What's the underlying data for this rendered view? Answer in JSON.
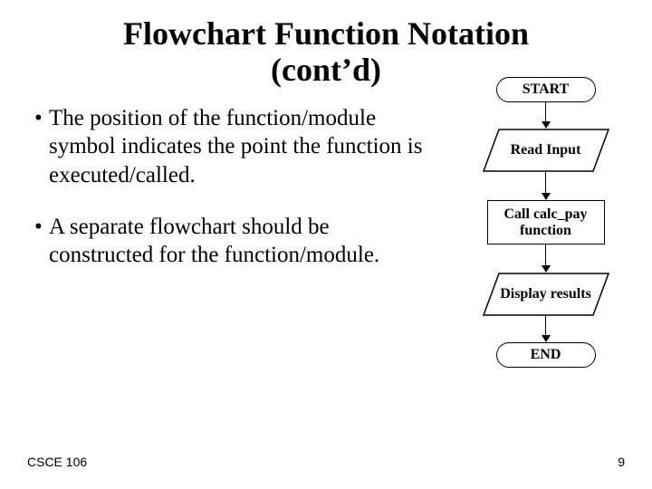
{
  "title_line1": "Flowchart Function Notation",
  "title_line2": "(cont’d)",
  "bullets": [
    "The position of the function/module symbol indicates the point the function is executed/called.",
    "A separate flowchart should be constructed for the function/module."
  ],
  "flow": {
    "start": "START",
    "read": "Read Input",
    "call": "Call calc_pay function",
    "display": "Display results",
    "end": "END"
  },
  "footer": {
    "left": "CSCE 106",
    "right": "9"
  }
}
